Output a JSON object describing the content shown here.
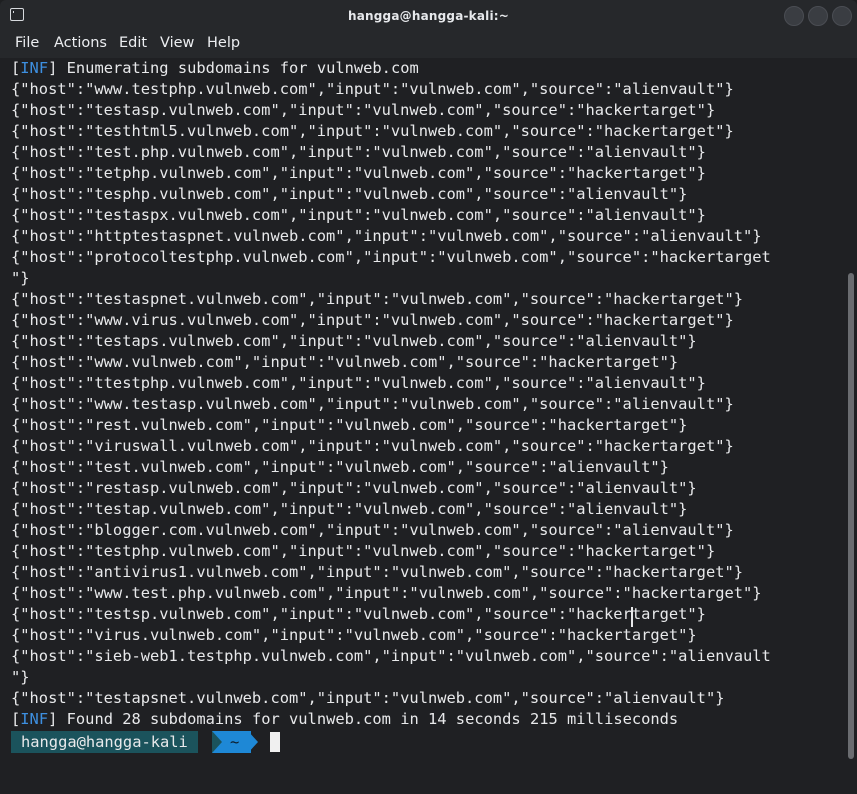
{
  "window": {
    "title": "hangga@hangga-kali:~",
    "icon": "terminal-icon"
  },
  "menu": [
    "File",
    "Actions",
    "Edit",
    "View",
    "Help"
  ],
  "output": {
    "tag": "INF",
    "start_msg": " Enumerating subdomains for vulnweb.com",
    "lines": [
      "{\"host\":\"www.testphp.vulnweb.com\",\"input\":\"vulnweb.com\",\"source\":\"alienvault\"}",
      "{\"host\":\"testasp.vulnweb.com\",\"input\":\"vulnweb.com\",\"source\":\"hackertarget\"}",
      "{\"host\":\"testhtml5.vulnweb.com\",\"input\":\"vulnweb.com\",\"source\":\"hackertarget\"}",
      "{\"host\":\"test.php.vulnweb.com\",\"input\":\"vulnweb.com\",\"source\":\"alienvault\"}",
      "{\"host\":\"tetphp.vulnweb.com\",\"input\":\"vulnweb.com\",\"source\":\"hackertarget\"}",
      "{\"host\":\"tesphp.vulnweb.com\",\"input\":\"vulnweb.com\",\"source\":\"alienvault\"}",
      "{\"host\":\"testaspx.vulnweb.com\",\"input\":\"vulnweb.com\",\"source\":\"alienvault\"}",
      "{\"host\":\"httptestaspnet.vulnweb.com\",\"input\":\"vulnweb.com\",\"source\":\"alienvault\"}",
      "{\"host\":\"protocoltestphp.vulnweb.com\",\"input\":\"vulnweb.com\",\"source\":\"hackertarget",
      "\"}",
      "{\"host\":\"testaspnet.vulnweb.com\",\"input\":\"vulnweb.com\",\"source\":\"hackertarget\"}",
      "{\"host\":\"www.virus.vulnweb.com\",\"input\":\"vulnweb.com\",\"source\":\"hackertarget\"}",
      "{\"host\":\"testaps.vulnweb.com\",\"input\":\"vulnweb.com\",\"source\":\"alienvault\"}",
      "{\"host\":\"www.vulnweb.com\",\"input\":\"vulnweb.com\",\"source\":\"hackertarget\"}",
      "{\"host\":\"ttestphp.vulnweb.com\",\"input\":\"vulnweb.com\",\"source\":\"alienvault\"}",
      "{\"host\":\"www.testasp.vulnweb.com\",\"input\":\"vulnweb.com\",\"source\":\"alienvault\"}",
      "{\"host\":\"rest.vulnweb.com\",\"input\":\"vulnweb.com\",\"source\":\"hackertarget\"}",
      "{\"host\":\"viruswall.vulnweb.com\",\"input\":\"vulnweb.com\",\"source\":\"hackertarget\"}",
      "{\"host\":\"test.vulnweb.com\",\"input\":\"vulnweb.com\",\"source\":\"alienvault\"}",
      "{\"host\":\"restasp.vulnweb.com\",\"input\":\"vulnweb.com\",\"source\":\"alienvault\"}",
      "{\"host\":\"testap.vulnweb.com\",\"input\":\"vulnweb.com\",\"source\":\"alienvault\"}",
      "{\"host\":\"blogger.com.vulnweb.com\",\"input\":\"vulnweb.com\",\"source\":\"alienvault\"}",
      "{\"host\":\"testphp.vulnweb.com\",\"input\":\"vulnweb.com\",\"source\":\"hackertarget\"}",
      "{\"host\":\"antivirus1.vulnweb.com\",\"input\":\"vulnweb.com\",\"source\":\"hackertarget\"}",
      "{\"host\":\"www.test.php.vulnweb.com\",\"input\":\"vulnweb.com\",\"source\":\"hackertarget\"}",
      "{\"host\":\"testsp.vulnweb.com\",\"input\":\"vulnweb.com\",\"source\":\"hackertarget\"}",
      "{\"host\":\"virus.vulnweb.com\",\"input\":\"vulnweb.com\",\"source\":\"hackertarget\"}",
      "{\"host\":\"sieb-web1.testphp.vulnweb.com\",\"input\":\"vulnweb.com\",\"source\":\"alienvault",
      "\"}",
      "{\"host\":\"testapsnet.vulnweb.com\",\"input\":\"vulnweb.com\",\"source\":\"alienvault\"}"
    ],
    "end_msg": " Found 28 subdomains for vulnweb.com in 14 seconds 215 milliseconds"
  },
  "prompt": {
    "user_host": "hangga@hangga-kali",
    "dir": "~"
  },
  "colors": {
    "background": "#1f2023",
    "tag": "#3d8fe0",
    "prompt_user_bg": "#1b535c",
    "prompt_dir_bg": "#1e88d6"
  }
}
